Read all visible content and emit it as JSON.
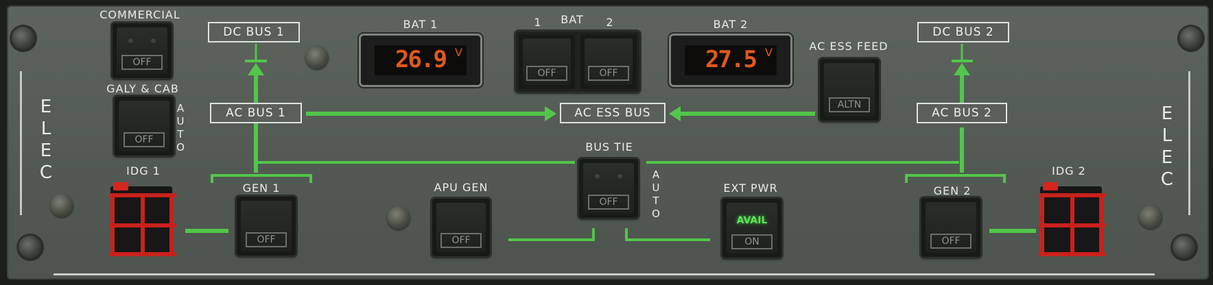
{
  "panel": {
    "title_left": [
      "E",
      "L",
      "E",
      "C"
    ],
    "title_right": [
      "E",
      "L",
      "E",
      "C"
    ]
  },
  "labels": {
    "commercial": "COMMERCIAL",
    "galy_cab": "GALY & CAB",
    "galy_auto": [
      "A",
      "U",
      "T",
      "O"
    ],
    "idg1": "IDG 1",
    "idg2": "IDG 2",
    "gen1": "GEN 1",
    "gen2": "GEN 2",
    "apu_gen": "APU GEN",
    "bus_tie": "BUS TIE",
    "bus_tie_auto": [
      "A",
      "U",
      "T",
      "O"
    ],
    "ext_pwr": "EXT PWR",
    "bat1": "BAT 1",
    "bat2": "BAT 2",
    "bat": "BAT",
    "bat_sw1": "1",
    "bat_sw2": "2",
    "ac_ess_feed": "AC ESS FEED"
  },
  "buses": {
    "dc_bus_1": "DC BUS 1",
    "dc_bus_2": "DC BUS 2",
    "ac_bus_1": "AC BUS 1",
    "ac_bus_2": "AC BUS 2",
    "ac_ess_bus": "AC ESS BUS"
  },
  "buttons": {
    "commercial": "OFF",
    "galy_cab": "OFF",
    "gen1": "OFF",
    "gen2": "OFF",
    "apu_gen": "OFF",
    "bus_tie": "OFF",
    "ext_pwr_upper": "AVAIL",
    "ext_pwr_lower": "ON",
    "bat1": "OFF",
    "bat2": "OFF",
    "ac_ess_feed": "ALTN"
  },
  "displays": {
    "bat1_voltage": "26.9",
    "bat2_voltage": "27.5",
    "unit": "V"
  },
  "colors": {
    "panel": "#575e58",
    "flow_line": "#52c64a",
    "display_digits": "#e0591c",
    "avail_light": "#5fe35a",
    "idg_guard": "#c8211c"
  }
}
